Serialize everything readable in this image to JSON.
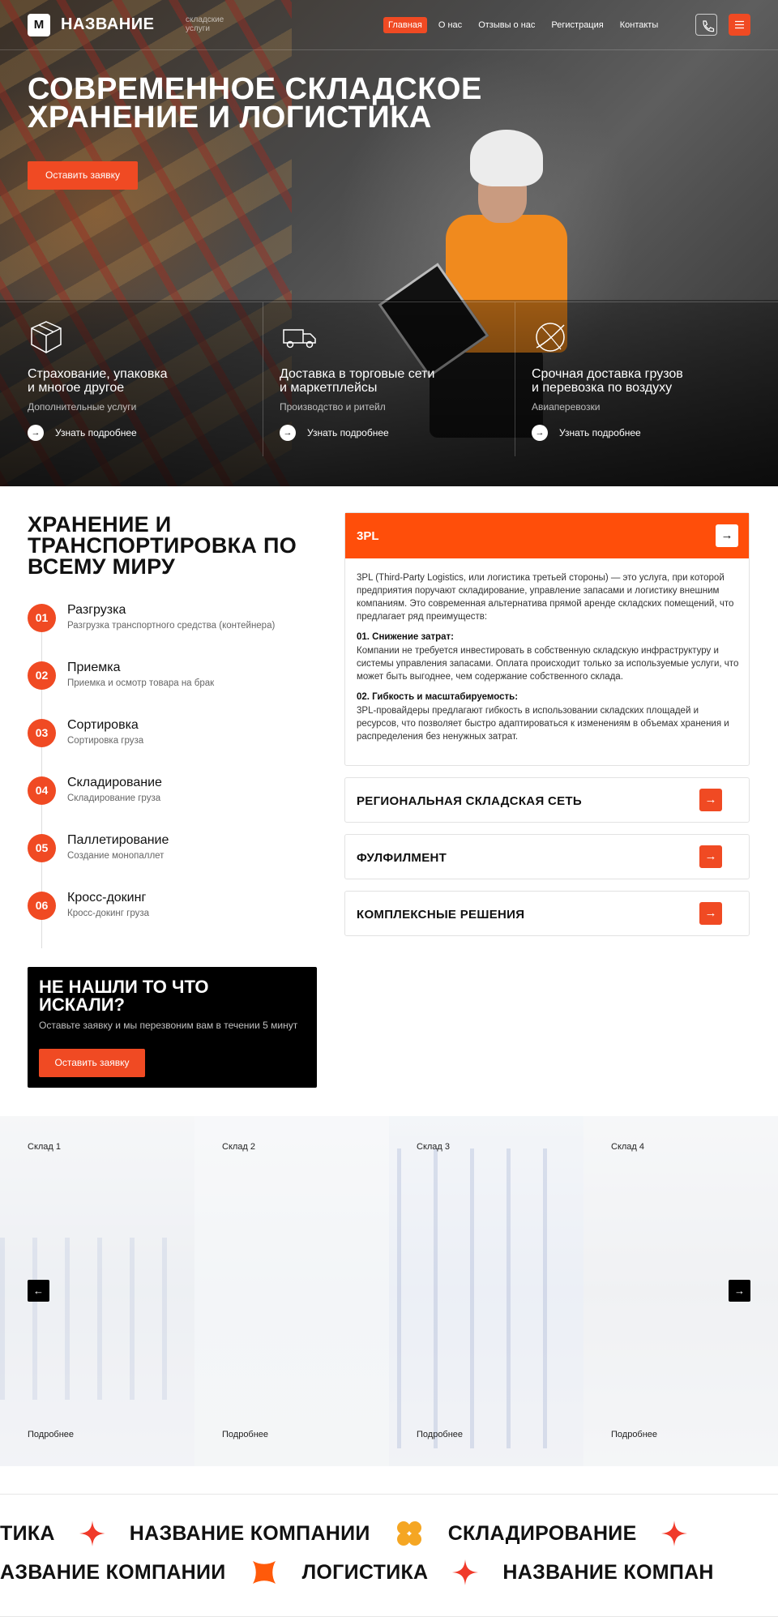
{
  "header": {
    "logo_mark": "M",
    "logo_name": "НАЗВАНИЕ",
    "logo_sub": "складские услуги",
    "nav": [
      "Главная",
      "О нас",
      "Отзывы о нас",
      "Регистрация",
      "Контакты"
    ],
    "active_nav": "Главная"
  },
  "hero": {
    "title_line1": "СОВРЕМЕННОЕ СКЛАДСКОЕ",
    "title_line2": "ХРАНЕНИЕ И ЛОГИСТИКА",
    "cta": "Оставить заявку"
  },
  "services": [
    {
      "icon": "box-icon",
      "title_line1": "Страхование, упаковка",
      "title_line2": "и многое другое",
      "subtitle": "Дополнительные услуги",
      "more": "Узнать подробнее"
    },
    {
      "icon": "truck-icon",
      "title_line1": "Доставка в торговые сети",
      "title_line2": "и маркетплейсы",
      "subtitle": "Производство и ритейл",
      "more": "Узнать подробнее"
    },
    {
      "icon": "globe-icon",
      "title_line1": "Срочная доставка грузов",
      "title_line2": "и перевозка по воздуху",
      "subtitle": "Авиаперевозки",
      "more": "Узнать подробнее"
    }
  ],
  "section2": {
    "title": "ХРАНЕНИЕ И ТРАНСПОРТИРОВКА ПО ВСЕМУ МИРУ",
    "steps": [
      {
        "num": "01",
        "title": "Разгрузка",
        "desc": "Разгрузка транспортного средства (контейнера)"
      },
      {
        "num": "02",
        "title": "Приемка",
        "desc": "Приемка и осмотр товара на брак"
      },
      {
        "num": "03",
        "title": "Сортировка",
        "desc": "Сортировка груза"
      },
      {
        "num": "04",
        "title": "Складирование",
        "desc": "Складирование груза"
      },
      {
        "num": "05",
        "title": "Паллетирование",
        "desc": "Создание монопаллет"
      },
      {
        "num": "06",
        "title": "Кросс-докинг",
        "desc": "Кросс-докинг груза"
      }
    ],
    "not_found": {
      "title": "НЕ НАШЛИ ТО ЧТО ИСКАЛИ?",
      "text": "Оставьте заявку и мы перезвоним вам в течении 5 минут",
      "button": "Оставить заявку"
    },
    "accordion_open": {
      "title": "3PL",
      "intro": "3PL (Third-Party Logistics, или логистика третьей стороны) — это услуга, при которой предприятия поручают складирование, управление запасами и логистику внешним компаниям. Это современная альтернатива прямой аренде складских помещений, что предлагает ряд преимуществ:",
      "point1_title": "01. Снижение затрат:",
      "point1_text": "Компании не требуется инвестировать в собственную складскую инфраструктуру и системы управления запасами. Оплата происходит только за используемые услуги, что может быть выгоднее, чем содержание собственного склада.",
      "point2_title": "02. Гибкость и масштабируемость:",
      "point2_text": "3PL-провайдеры предлагают гибкость в использовании складских площадей и ресурсов, что позволяет быстро адаптироваться к изменениям в объемах хранения и распределения без ненужных затрат."
    },
    "accordion_closed": [
      "РЕГИОНАЛЬНАЯ СКЛАДСКАЯ СЕТЬ",
      "ФУЛФИЛМЕНТ",
      "КОМПЛЕКСНЫЕ РЕШЕНИЯ"
    ]
  },
  "warehouses": {
    "items": [
      {
        "label": "Склад 1",
        "more": "Подробнее"
      },
      {
        "label": "Склад 2",
        "more": "Подробнее"
      },
      {
        "label": "Склад 3",
        "more": "Подробнее"
      },
      {
        "label": "Склад 4",
        "more": "Подробнее"
      }
    ]
  },
  "marquee": {
    "row1": [
      "ТИКА",
      "НАЗВАНИЕ КОМПАНИИ",
      "СКЛАДИРОВАНИЕ"
    ],
    "row2": [
      "АЗВАНИЕ КОМПАНИИ",
      "ЛОГИСТИКА",
      "НАЗВАНИЕ КОМПАН"
    ]
  },
  "colors": {
    "accent": "#f04a23",
    "accent_bright": "#ff4e0a",
    "clover": "#f5a623"
  }
}
